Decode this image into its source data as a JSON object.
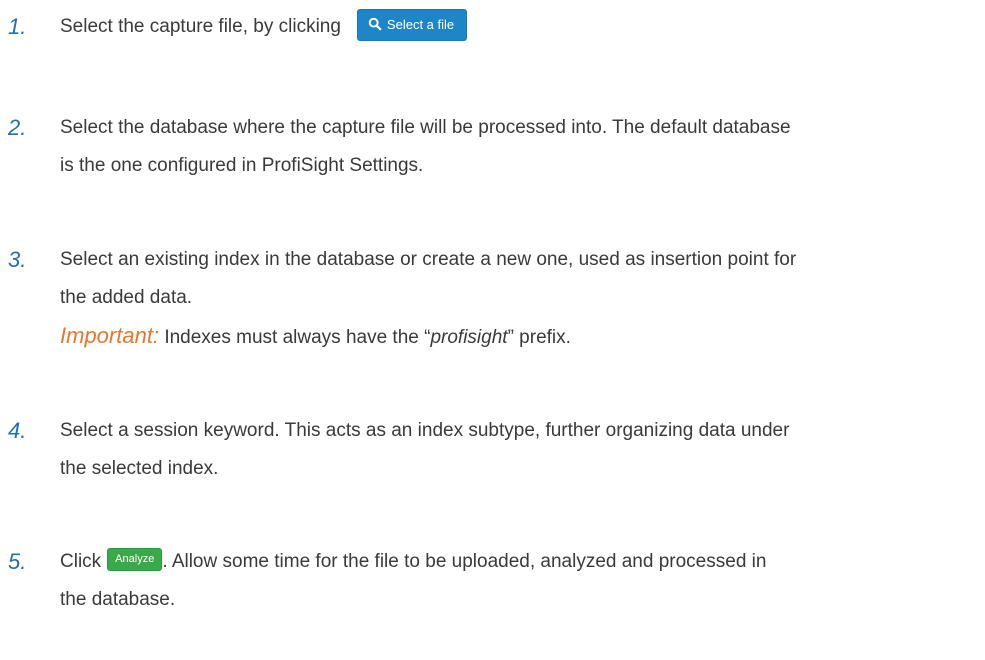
{
  "steps": [
    {
      "number": "1.",
      "text_before_button": "Select the capture file, by clicking",
      "button_label": "Select a file",
      "button_icon": "search-icon"
    },
    {
      "number": "2.",
      "text_line1": "Select the database where the capture file will be processed into. The default database",
      "text_line2": "is the one configured in ProfiSight Settings."
    },
    {
      "number": "3.",
      "text_line1": "Select an existing index in the database or create a new one, used as insertion point for",
      "text_line2": "the added data.",
      "important_label": "Important:",
      "important_text_before": " Indexes must always have the “",
      "important_emphasis": "profisight",
      "important_text_after": "” prefix."
    },
    {
      "number": "4.",
      "text_line1": "Select a session keyword. This acts as an index subtype, further organizing data under",
      "text_line2": "the selected index."
    },
    {
      "number": "5.",
      "text_before_button": "Click",
      "button_label": "Analyze",
      "text_after_button": ". Allow some time for the file to be uploaded, analyzed and processed in",
      "text_line2": "the database."
    }
  ],
  "colors": {
    "number": "#1f6fb2",
    "important": "#e8762d",
    "primary_button": "#1e86c8",
    "success_button": "#3aa94a"
  }
}
